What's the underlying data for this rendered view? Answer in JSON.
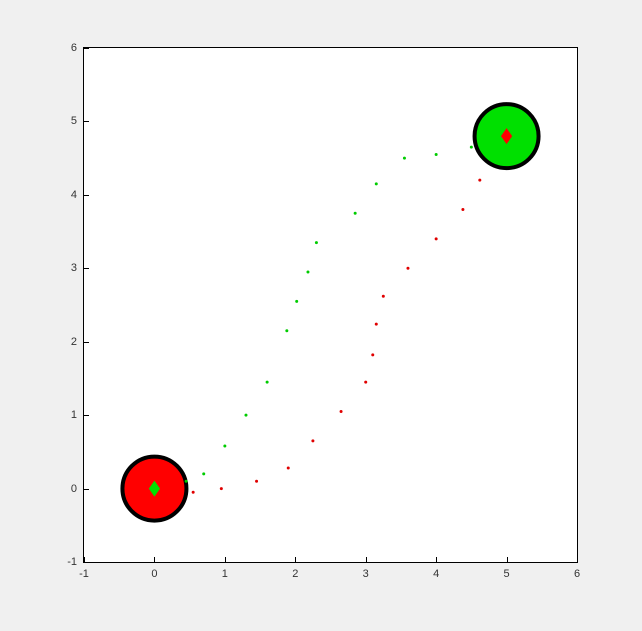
{
  "chart_data": {
    "type": "scatter",
    "xlim": [
      -1,
      6
    ],
    "ylim": [
      -1,
      6
    ],
    "xticks": [
      -1,
      0,
      1,
      2,
      3,
      4,
      5,
      6
    ],
    "yticks": [
      -1,
      0,
      1,
      2,
      3,
      4,
      5,
      6
    ],
    "series": [
      {
        "name": "big-circle-red",
        "type": "marker",
        "shape": "circle",
        "fill": "#ff0000",
        "edge": "#000000",
        "edgeWidth": 4,
        "size": 64,
        "x": [
          0
        ],
        "y": [
          0
        ]
      },
      {
        "name": "big-circle-green",
        "type": "marker",
        "shape": "circle",
        "fill": "#00e000",
        "edge": "#000000",
        "edgeWidth": 4,
        "size": 64,
        "x": [
          5
        ],
        "y": [
          4.8
        ]
      },
      {
        "name": "diamond-green",
        "type": "marker",
        "shape": "diamond",
        "fill": "#00e000",
        "size": 16,
        "x": [
          0
        ],
        "y": [
          0
        ]
      },
      {
        "name": "diamond-red",
        "type": "marker",
        "shape": "diamond",
        "fill": "#ff0000",
        "size": 16,
        "x": [
          5
        ],
        "y": [
          4.8
        ]
      },
      {
        "name": "dots-green",
        "type": "dots",
        "color": "#00cc00",
        "size": 3,
        "x": [
          0.45,
          0.7,
          1.0,
          1.3,
          1.6,
          1.88,
          2.02,
          2.18,
          2.3,
          2.85,
          3.15,
          3.55,
          4.0,
          4.5
        ],
        "y": [
          0.1,
          0.2,
          0.58,
          1.0,
          1.45,
          2.15,
          2.55,
          2.95,
          3.35,
          3.75,
          4.15,
          4.5,
          4.55,
          4.65
        ]
      },
      {
        "name": "dots-red",
        "type": "dots",
        "color": "#e00000",
        "size": 3,
        "x": [
          0.55,
          0.95,
          1.45,
          1.9,
          2.25,
          2.65,
          3.0,
          3.1,
          3.15,
          3.25,
          3.6,
          4.0,
          4.38,
          4.62
        ],
        "y": [
          -0.05,
          0.0,
          0.1,
          0.28,
          0.65,
          1.05,
          1.45,
          1.82,
          2.24,
          2.62,
          3.0,
          3.4,
          3.8,
          4.2
        ]
      }
    ]
  }
}
